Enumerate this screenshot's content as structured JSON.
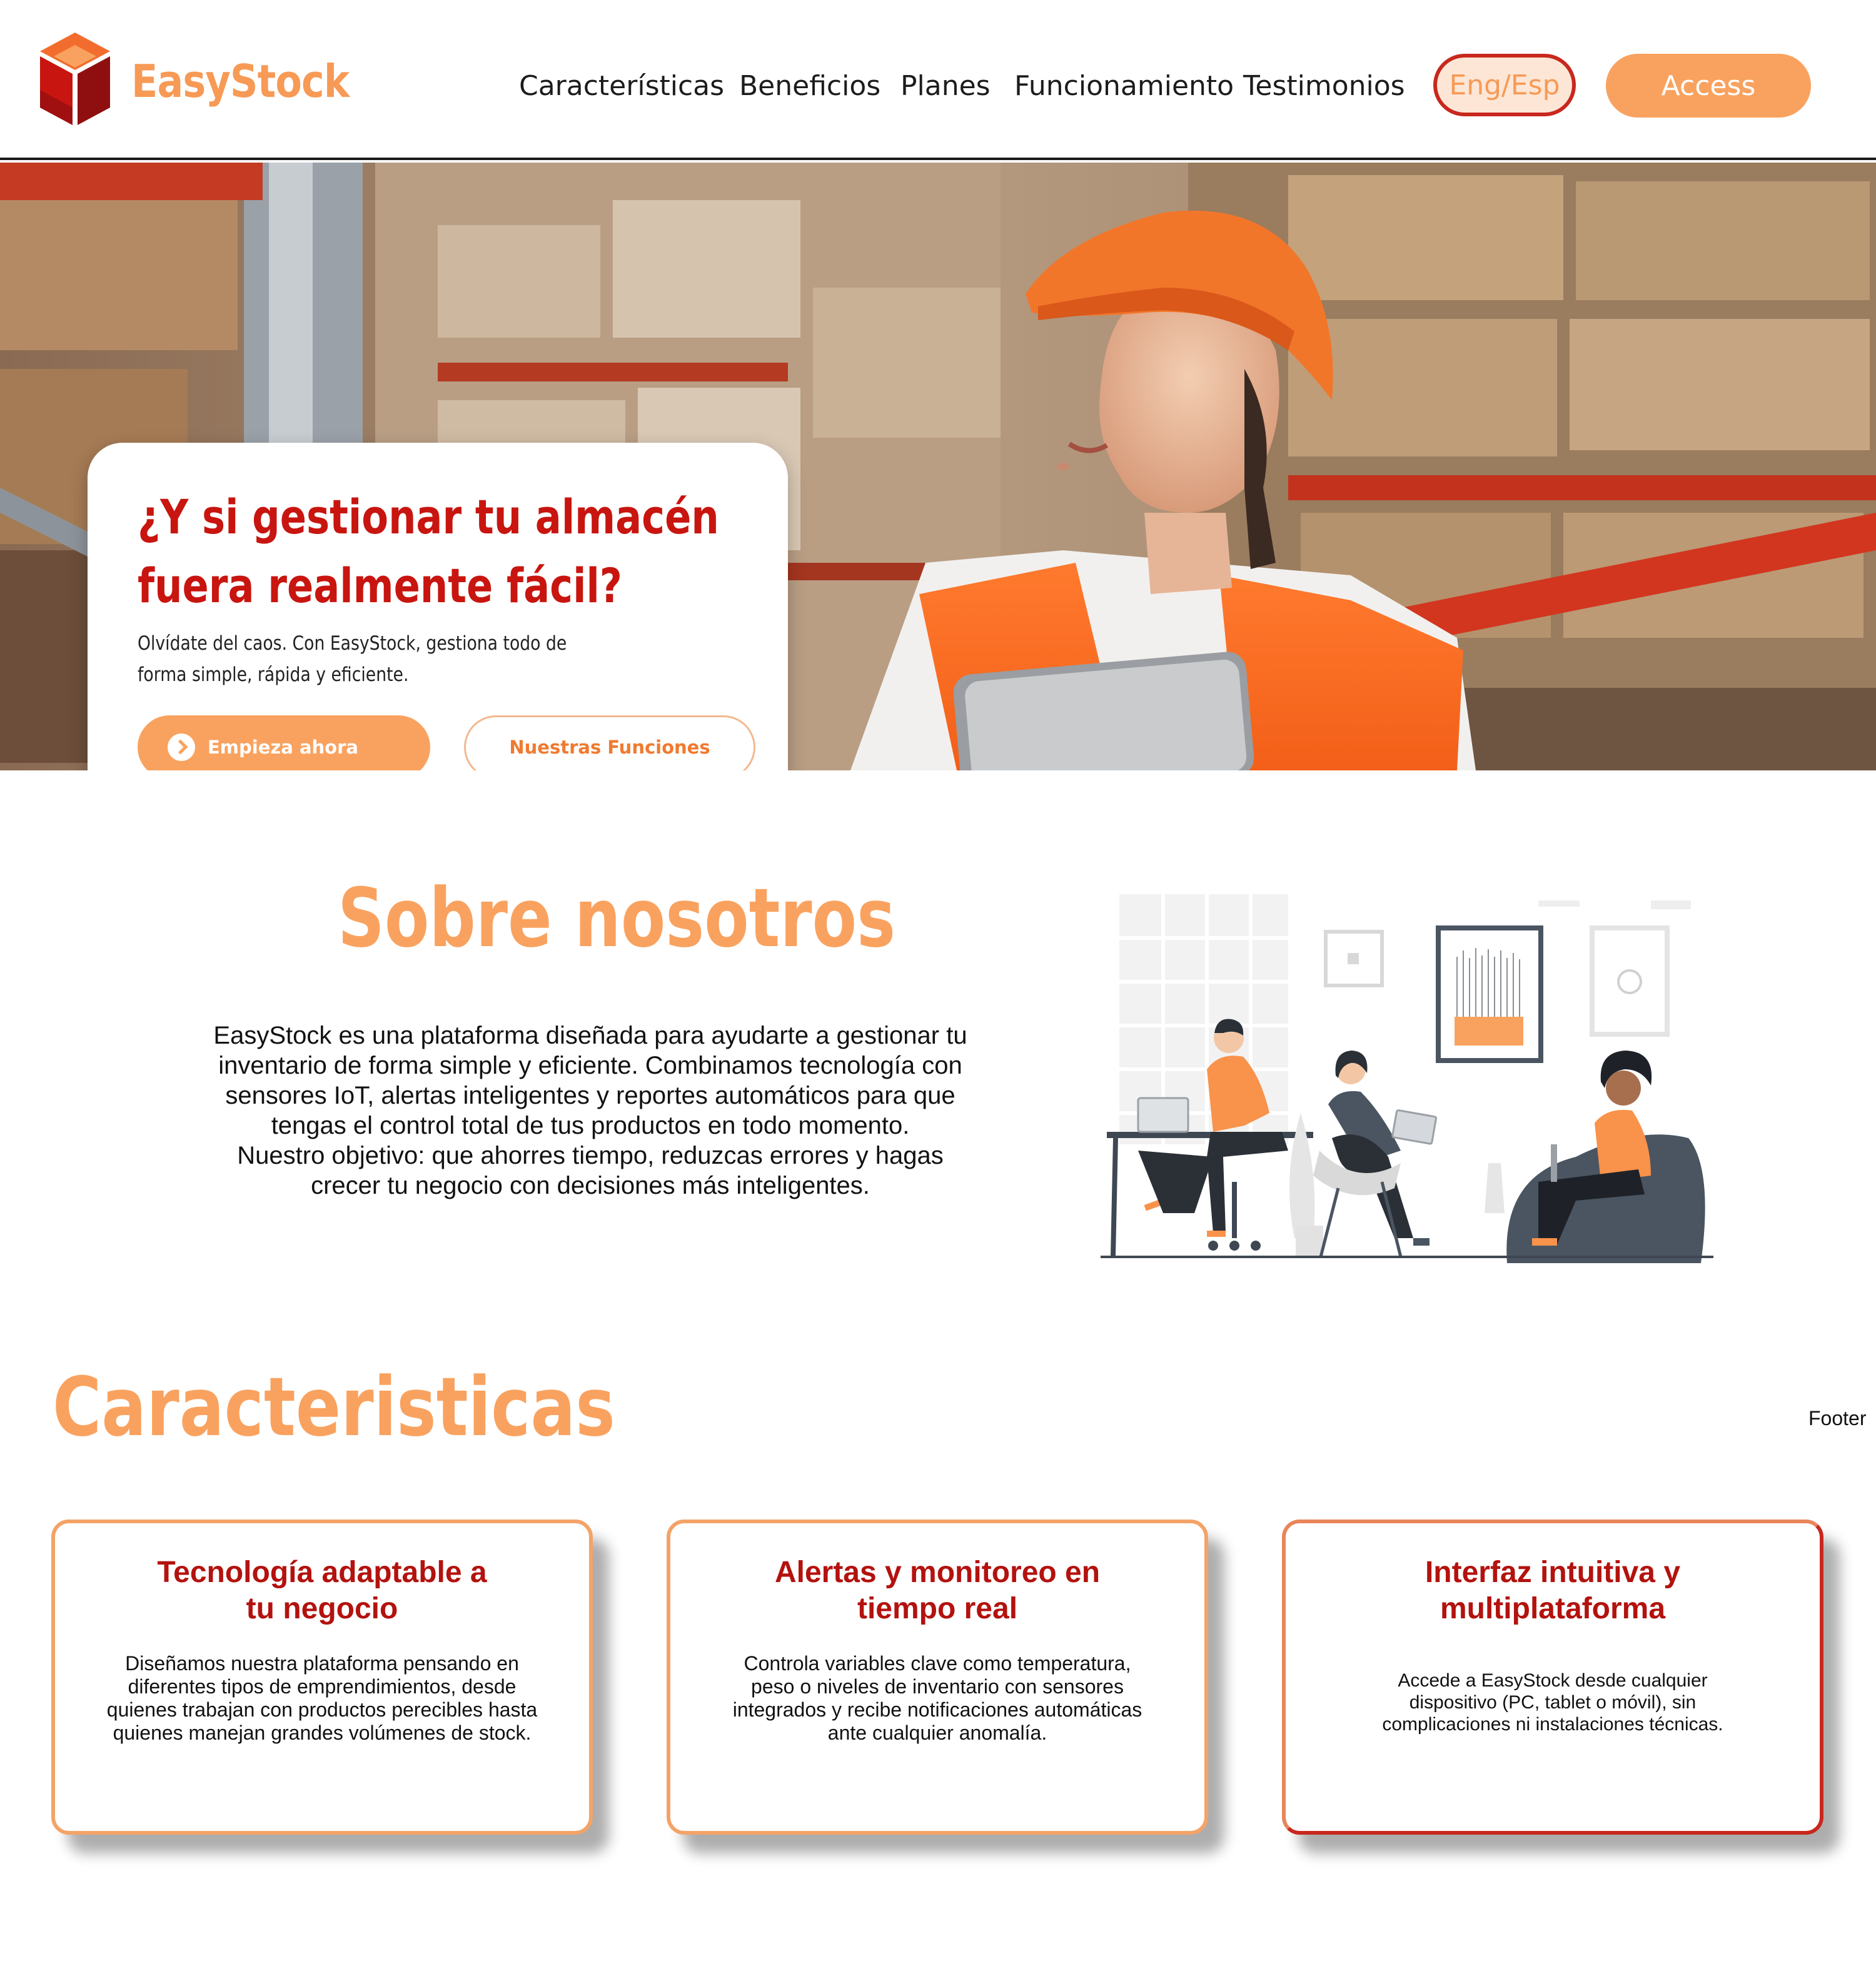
{
  "brand": {
    "name": "EasyStock",
    "accent_color": "#f9a25f",
    "primary_red": "#c8150f"
  },
  "nav": {
    "links": [
      "Características",
      "Beneficios",
      "Planes",
      "Funcionamiento",
      "Testimonios"
    ],
    "lang_label": "Eng/Esp",
    "access_label": "Access"
  },
  "hero": {
    "title_lines": [
      "¿Y si gestionar tu almacén",
      "fuera realmente fácil?"
    ],
    "subtitle_lines": [
      "Olvídate del caos. Con EasyStock, gestiona todo de",
      "forma simple, rápida y eficiente."
    ],
    "cta_primary": "Empieza ahora",
    "cta_secondary": "Nuestras Funciones",
    "image": "warehouse-worker-photo"
  },
  "about": {
    "title": "Sobre nosotros",
    "text_lines": [
      "EasyStock es una plataforma diseñada para ayudarte a gestionar tu",
      "inventario de forma simple y eficiente. Combinamos tecnología con",
      "sensores IoT, alertas inteligentes y reportes automáticos para que",
      "tengas el control total de tus productos en todo momento.",
      "Nuestro objetivo: que ahorres tiempo, reduzcas errores y hagas",
      "crecer tu negocio con decisiones más inteligentes."
    ],
    "illustration": "team-office-illustration"
  },
  "features": {
    "title": "Caracteristicas",
    "footer_label": "Footer",
    "cards": [
      {
        "title_lines": [
          "Tecnología adaptable a",
          "tu negocio"
        ],
        "text_lines": [
          "Diseñamos nuestra plataforma pensando en",
          "diferentes tipos de emprendimientos, desde",
          "quienes trabajan con productos perecibles hasta",
          "quienes manejan grandes volúmenes de stock."
        ]
      },
      {
        "title_lines": [
          "Alertas y monitoreo en",
          "tiempo real"
        ],
        "text_lines": [
          "Controla variables clave como temperatura,",
          "peso o niveles de inventario con sensores",
          "integrados y recibe notificaciones automáticas",
          "ante cualquier anomalía."
        ]
      },
      {
        "title_lines": [
          "Interfaz intuitiva y",
          "multiplataforma"
        ],
        "text_lines": [
          "Accede a EasyStock desde cualquier",
          "dispositivo (PC, tablet o móvil), sin",
          "complicaciones ni instalaciones técnicas."
        ]
      }
    ]
  }
}
